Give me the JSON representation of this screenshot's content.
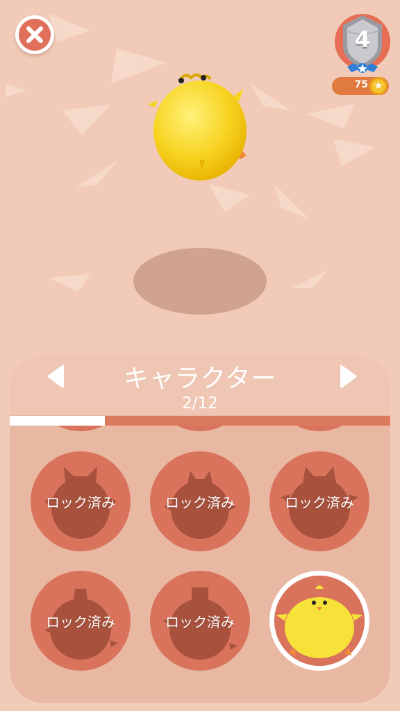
{
  "hud": {
    "level": "4",
    "coins": "75"
  },
  "selector": {
    "title": "キャラクター",
    "counter": "2/12",
    "progress_fraction": 0.25
  },
  "slots": [
    {
      "label": "ロック済み",
      "locked": true
    },
    {
      "label": "ロック済み",
      "locked": true
    },
    {
      "label": "ロック済み",
      "locked": true
    },
    {
      "label": "ロック済み",
      "locked": true
    },
    {
      "label": "ロック済み",
      "locked": true
    },
    {
      "label": "",
      "locked": false,
      "selected": true
    }
  ],
  "colors": {
    "background": "#f1cbb7",
    "accent": "#e0705a",
    "slot": "#d9735c",
    "chick": "#f7e23a"
  }
}
